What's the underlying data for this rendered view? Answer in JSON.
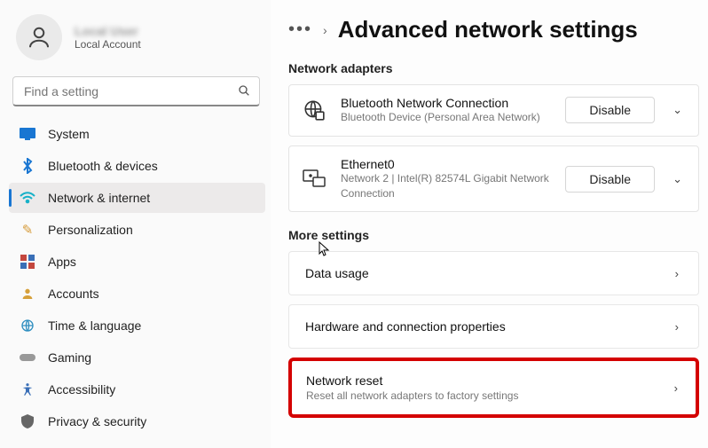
{
  "account": {
    "name": "Local User",
    "sub": "Local Account"
  },
  "search": {
    "placeholder": "Find a setting"
  },
  "sidebar": {
    "items": [
      {
        "label": "System",
        "icon": "🖥️",
        "color": "#1976d2"
      },
      {
        "label": "Bluetooth & devices",
        "icon": "B",
        "color": "#1976d2"
      },
      {
        "label": "Network & internet",
        "icon": "wifi",
        "color": "#17b1c8"
      },
      {
        "label": "Personalization",
        "icon": "✎",
        "color": "#d69b3a"
      },
      {
        "label": "Apps",
        "icon": "▦",
        "color": "#c4473e"
      },
      {
        "label": "Accounts",
        "icon": "👤",
        "color": "#d6a03a"
      },
      {
        "label": "Time & language",
        "icon": "🌐",
        "color": "#2e8ec0"
      },
      {
        "label": "Gaming",
        "icon": "🎮",
        "color": "#888"
      },
      {
        "label": "Accessibility",
        "icon": "♿",
        "color": "#3a6fb7"
      },
      {
        "label": "Privacy & security",
        "icon": "🛡",
        "color": "#555"
      }
    ]
  },
  "breadcrumb": {
    "title": "Advanced network settings"
  },
  "sections": {
    "adapters_h": "Network adapters",
    "more_h": "More settings"
  },
  "adapters": [
    {
      "title": "Bluetooth Network Connection",
      "sub": "Bluetooth Device (Personal Area Network)",
      "action": "Disable"
    },
    {
      "title": "Ethernet0",
      "sub": "Network 2 | Intel(R) 82574L Gigabit Network Connection",
      "action": "Disable"
    }
  ],
  "rows": [
    {
      "title": "Data usage",
      "sub": ""
    },
    {
      "title": "Hardware and connection properties",
      "sub": ""
    },
    {
      "title": "Network reset",
      "sub": "Reset all network adapters to factory settings"
    }
  ]
}
